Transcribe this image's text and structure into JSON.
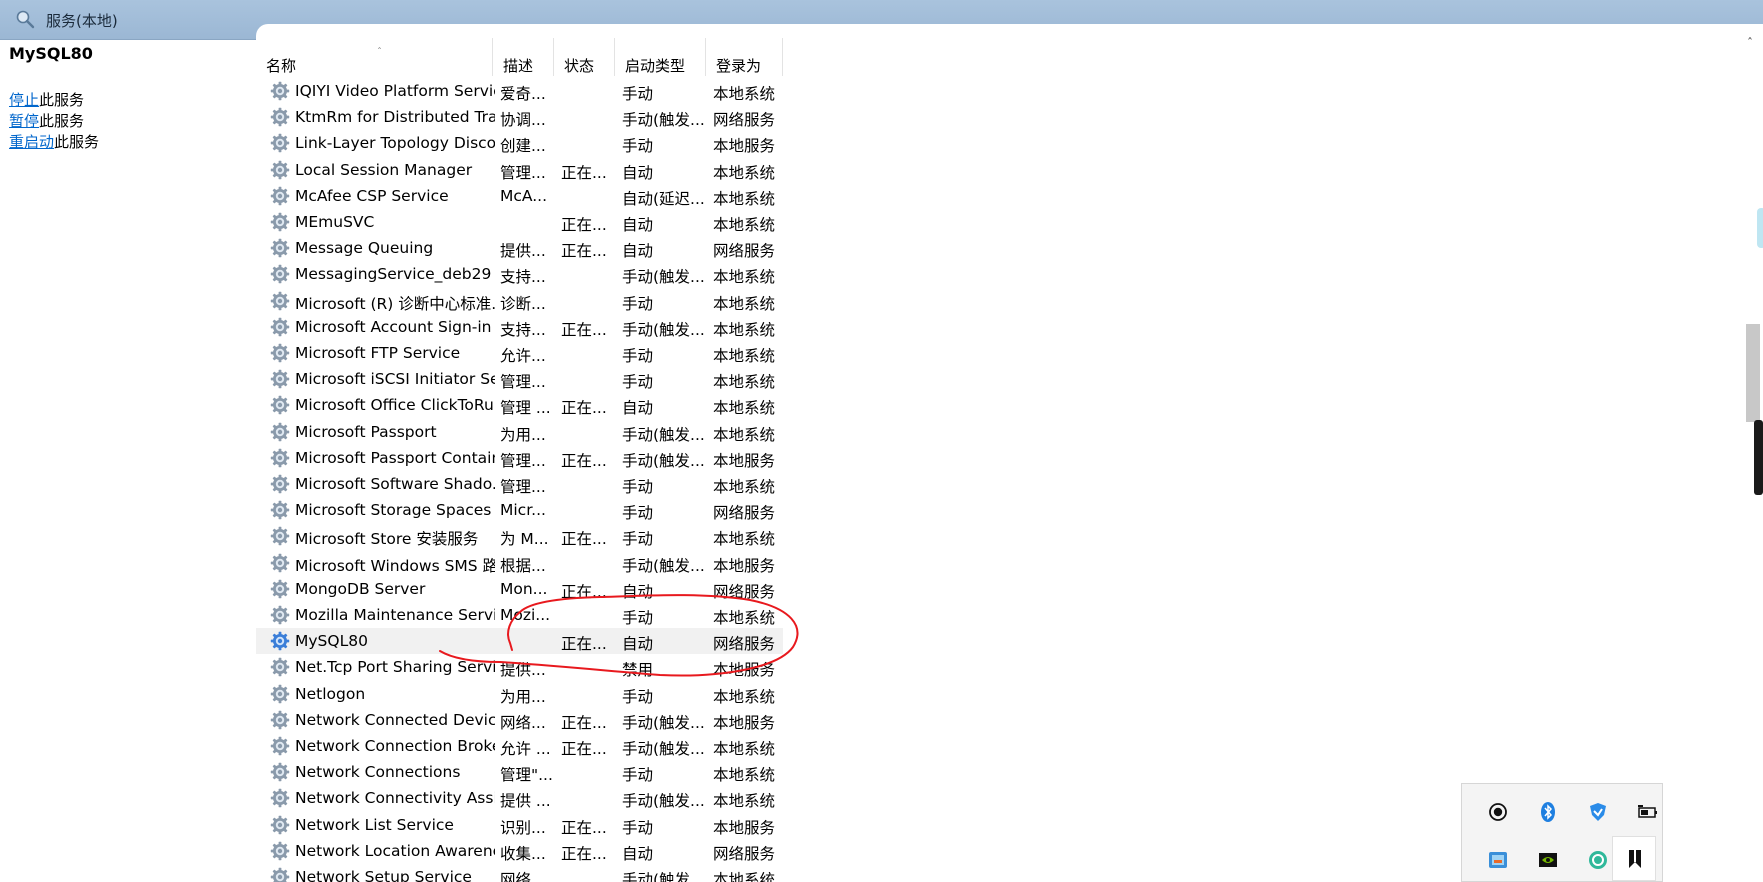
{
  "window": {
    "title": "服务(本地)",
    "title_icon": "magnifier-icon"
  },
  "left": {
    "service_name": "MySQL80",
    "actions": [
      {
        "link": "停止",
        "suffix": "此服务"
      },
      {
        "link": "暂停",
        "suffix": "此服务"
      },
      {
        "link": "重启动",
        "suffix": "此服务"
      }
    ]
  },
  "columns": {
    "name": "名称",
    "desc": "描述",
    "status": "状态",
    "startup": "启动类型",
    "logon": "登录为",
    "sort_indicator": "ˆ"
  },
  "rows": [
    {
      "name": "IQIYI Video Platform Service",
      "desc": "爱奇...",
      "status": "",
      "startup": "手动",
      "logon": "本地系统"
    },
    {
      "name": "KtmRm for Distributed Tra...",
      "desc": "协调...",
      "status": "",
      "startup": "手动(触发...",
      "logon": "网络服务"
    },
    {
      "name": "Link-Layer Topology Disco...",
      "desc": "创建...",
      "status": "",
      "startup": "手动",
      "logon": "本地服务"
    },
    {
      "name": "Local Session Manager",
      "desc": "管理...",
      "status": "正在...",
      "startup": "自动",
      "logon": "本地系统"
    },
    {
      "name": "McAfee CSP Service",
      "desc": "McA...",
      "status": "",
      "startup": "自动(延迟...",
      "logon": "本地系统"
    },
    {
      "name": "MEmuSVC",
      "desc": "",
      "status": "正在...",
      "startup": "自动",
      "logon": "本地系统"
    },
    {
      "name": "Message Queuing",
      "desc": "提供...",
      "status": "正在...",
      "startup": "自动",
      "logon": "网络服务"
    },
    {
      "name": "MessagingService_deb29",
      "desc": "支持...",
      "status": "",
      "startup": "手动(触发...",
      "logon": "本地系统"
    },
    {
      "name": "Microsoft (R) 诊断中心标准...",
      "desc": "诊断...",
      "status": "",
      "startup": "手动",
      "logon": "本地系统"
    },
    {
      "name": "Microsoft Account Sign-in ...",
      "desc": "支持...",
      "status": "正在...",
      "startup": "手动(触发...",
      "logon": "本地系统"
    },
    {
      "name": "Microsoft FTP Service",
      "desc": "允许...",
      "status": "",
      "startup": "手动",
      "logon": "本地系统"
    },
    {
      "name": "Microsoft iSCSI Initiator Ser...",
      "desc": "管理...",
      "status": "",
      "startup": "手动",
      "logon": "本地系统"
    },
    {
      "name": "Microsoft Office ClickToRu...",
      "desc": "管理 ...",
      "status": "正在...",
      "startup": "自动",
      "logon": "本地系统"
    },
    {
      "name": "Microsoft Passport",
      "desc": "为用...",
      "status": "",
      "startup": "手动(触发...",
      "logon": "本地系统"
    },
    {
      "name": "Microsoft Passport Container",
      "desc": "管理...",
      "status": "正在...",
      "startup": "手动(触发...",
      "logon": "本地服务"
    },
    {
      "name": "Microsoft Software Shado...",
      "desc": "管理...",
      "status": "",
      "startup": "手动",
      "logon": "本地系统"
    },
    {
      "name": "Microsoft Storage Spaces S...",
      "desc": "Micr...",
      "status": "",
      "startup": "手动",
      "logon": "网络服务"
    },
    {
      "name": "Microsoft Store 安装服务",
      "desc": "为 M...",
      "status": "正在...",
      "startup": "手动",
      "logon": "本地系统"
    },
    {
      "name": "Microsoft Windows SMS 路...",
      "desc": "根据...",
      "status": "",
      "startup": "手动(触发...",
      "logon": "本地服务"
    },
    {
      "name": "MongoDB Server",
      "desc": "Mon...",
      "status": "正在...",
      "startup": "自动",
      "logon": "网络服务"
    },
    {
      "name": "Mozilla Maintenance Service",
      "desc": "Mozi...",
      "status": "",
      "startup": "手动",
      "logon": "本地系统"
    },
    {
      "name": "MySQL80",
      "desc": "",
      "status": "正在...",
      "startup": "自动",
      "logon": "网络服务",
      "selected": true
    },
    {
      "name": "Net.Tcp Port Sharing Service",
      "desc": "提供...",
      "status": "",
      "startup": "禁用",
      "logon": "本地服务"
    },
    {
      "name": "Netlogon",
      "desc": "为用...",
      "status": "",
      "startup": "手动",
      "logon": "本地系统"
    },
    {
      "name": "Network Connected Devic...",
      "desc": "网络...",
      "status": "正在...",
      "startup": "手动(触发...",
      "logon": "本地服务"
    },
    {
      "name": "Network Connection Broker",
      "desc": "允许 ...",
      "status": "正在...",
      "startup": "手动(触发...",
      "logon": "本地系统"
    },
    {
      "name": "Network Connections",
      "desc": "管理\"...",
      "status": "",
      "startup": "手动",
      "logon": "本地系统"
    },
    {
      "name": "Network Connectivity Assis...",
      "desc": "提供 ...",
      "status": "",
      "startup": "手动(触发...",
      "logon": "本地系统"
    },
    {
      "name": "Network List Service",
      "desc": "识别...",
      "status": "正在...",
      "startup": "手动",
      "logon": "本地服务"
    },
    {
      "name": "Network Location Awarene...",
      "desc": "收集...",
      "status": "正在...",
      "startup": "自动",
      "logon": "网络服务"
    },
    {
      "name": "Network Setup Service",
      "desc": "网络...",
      "status": "",
      "startup": "手动(触发...",
      "logon": "本地系统"
    }
  ],
  "scrollbar": {
    "up_arrow": "ˆ"
  },
  "tray": {
    "icons": [
      "record-icon",
      "bluetooth-icon",
      "shield-icon",
      "battery-icon",
      "network-app-icon",
      "nvidia-icon",
      "sync-icon",
      "bookmark-app-icon"
    ]
  },
  "colors": {
    "titlebar": "#a5c0db",
    "link": "#0066cc",
    "annotation": "#e8191e",
    "selected_row": "#f1f1f1"
  }
}
